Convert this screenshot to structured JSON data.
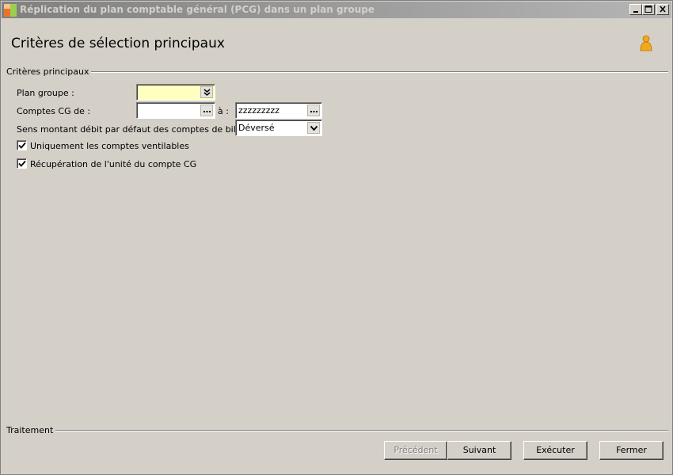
{
  "window": {
    "title": "Réplication du plan comptable général (PCG) dans un plan groupe",
    "minimize_icon": "minimize-icon",
    "maximize_icon": "maximize-icon",
    "close_icon": "close-icon"
  },
  "header": {
    "title": "Critères de sélection principaux",
    "user_icon": "person-icon"
  },
  "criteria": {
    "group_label": "Critères principaux",
    "plan_groupe": {
      "label": "Plan groupe :",
      "value": ""
    },
    "comptes_cg": {
      "label": "Comptes CG de :",
      "from_value": "",
      "to_label": "à :",
      "to_value": "zzzzzzzzz"
    },
    "sens_montant": {
      "label": "Sens montant débit par défaut des comptes de bilan :",
      "value": "Déversé"
    },
    "uniquement_ventilables": {
      "label": "Uniquement les comptes ventilables",
      "checked": true
    },
    "recuperation_unite": {
      "label": "Récupération de l'unité du compte CG",
      "checked": true
    }
  },
  "traitement": {
    "group_label": "Traitement",
    "precedent_label": "Précédent",
    "suivant_label": "Suivant",
    "executer_label": "Exécuter",
    "fermer_label": "Fermer"
  }
}
